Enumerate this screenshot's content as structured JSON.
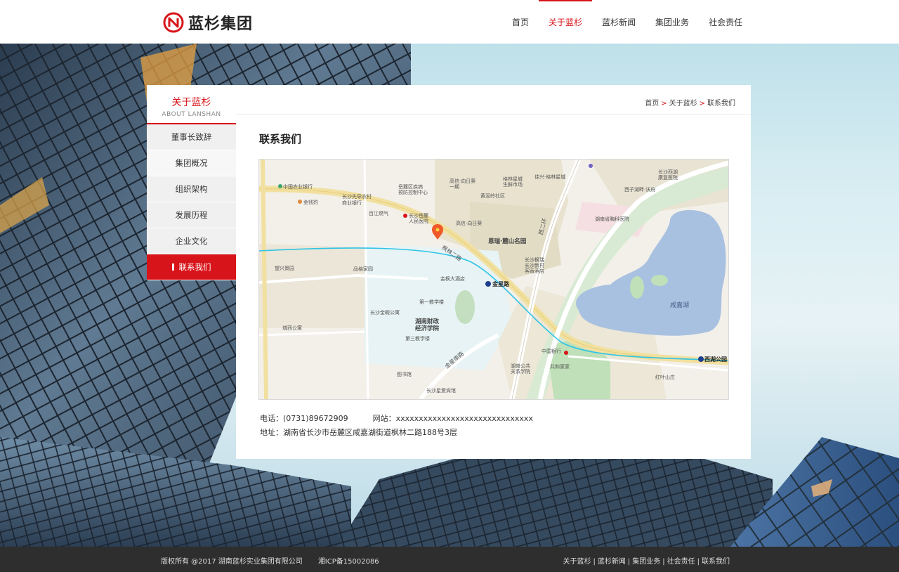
{
  "header": {
    "logo_text": "蓝杉集团",
    "nav": [
      {
        "label": "首页",
        "active": false
      },
      {
        "label": "关于蓝杉",
        "active": true
      },
      {
        "label": "蓝杉新闻",
        "active": false
      },
      {
        "label": "集团业务",
        "active": false
      },
      {
        "label": "社会责任",
        "active": false
      }
    ]
  },
  "sidebar": {
    "title": "关于蓝杉",
    "subtitle": "ABOUT LANSHAN",
    "items": [
      {
        "label": "董事长致辞"
      },
      {
        "label": "集团概况"
      },
      {
        "label": "组织架构"
      },
      {
        "label": "发展历程"
      },
      {
        "label": "企业文化"
      },
      {
        "label": "联系我们"
      }
    ]
  },
  "breadcrumb": {
    "home": "首页",
    "section": "关于蓝杉",
    "current": "联系我们",
    "separator": ">"
  },
  "content": {
    "title": "联系我们",
    "phone": "电话：(0731)89672909",
    "website": "网站：xxxxxxxxxxxxxxxxxxxxxxxxxxxxxx",
    "address": "地址：湖南省长沙市岳麓区咸嘉湖街道枫林二路188号3层"
  },
  "map": {
    "labels": {
      "bank_agri": "中国农业银行",
      "jinqianbao": "金钱豹",
      "zhangsha_xianzu": "长沙先导农村",
      "zhangsha_xianzu2": "商业银行",
      "baijiang": "百江燃气",
      "yuelu_disease": "岳麓区疾病",
      "yuelu_disease2": "预防控制中心",
      "yuelu_hospital": "长沙岳麓",
      "yuelu_hospital2": "人民医院",
      "gaoxin_1": "高信·向日葵",
      "gaoxin_1b": "一期",
      "gaoxin_2": "高信·向日葵",
      "huangni": "黄泥岭社区",
      "gelin": "格林星城",
      "gelin2": "生鲜市场",
      "jiaxing": "佳兴·格林星城",
      "xi_yi": "长沙西湖",
      "xi_yi2": "康复医院",
      "xizi": "西子湖畔·沃府",
      "hunan_chest": "湖南省胸科医院",
      "enrui": "恩瑞·麓山名园",
      "fenglin_road": "枫林二路",
      "xixian_road": "西二环",
      "wangxing": "望兴景园",
      "pinbai": "品格家园",
      "jinfeng": "金枫大酒店",
      "jinxing_station": "金星路",
      "jiaxiang": "长沙枫瑞",
      "jiaxiang2": "长沙新村",
      "jiaxiang3": "客香酒店",
      "first_school": "第一教学楼",
      "jindi": "长沙金暇公寓",
      "finance_univ": "湖南财政",
      "finance_univ2": "经济学院",
      "third_school": "第三教学楼",
      "chengxi": "城西公寓",
      "library": "图书馆",
      "jinxing_south": "金星南路",
      "xingai": "长沙星爱宾馆",
      "hunan_gong": "湖南公共",
      "hunan_gong2": "关系学院",
      "gonghe": "共和家家",
      "boc": "中国银行",
      "xianjia_lake": "咸嘉湖",
      "xihu_park": "西湖公园",
      "hongye": "红叶山庄"
    }
  },
  "footer": {
    "copyright": "版权所有 @2017 湖南蓝杉实业集团有限公司",
    "icp": "湘ICP备15002086",
    "links": [
      {
        "label": "关于蓝杉"
      },
      {
        "label": "蓝杉新闻"
      },
      {
        "label": "集团业务"
      },
      {
        "label": "社会责任"
      },
      {
        "label": "联系我们"
      }
    ],
    "separator": "|"
  },
  "colors": {
    "accent": "#d7141a",
    "footer_bg": "#2e2e2e",
    "sidebar_bg": "#f0f0f0",
    "lake": "#a9c1e0",
    "metro": "#2fc4e6"
  },
  "icons": {
    "logo": "lanshan-logo-icon",
    "map_pin": "map-pin-icon",
    "metro": "metro-station-icon"
  }
}
